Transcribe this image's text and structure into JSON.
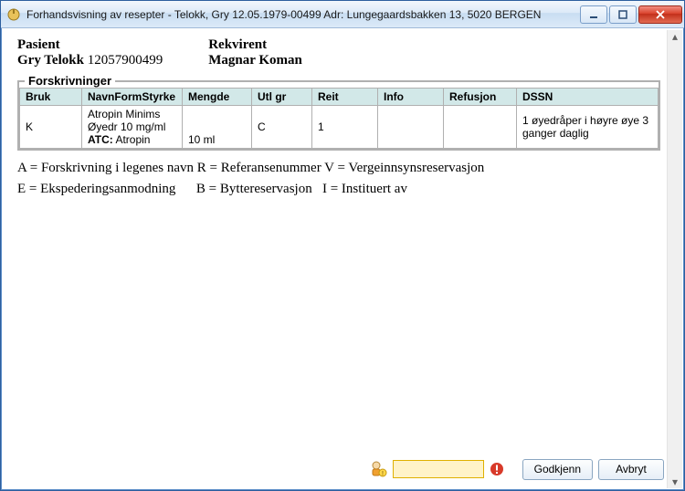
{
  "window": {
    "title": "Forhandsvisning av resepter - Telokk, Gry 12.05.1979-00499 Adr: Lungegaardsbakken 13, 5020 BERGEN"
  },
  "patient": {
    "label": "Pasient",
    "name": "Gry Telokk",
    "id": "12057900499"
  },
  "requester": {
    "label": "Rekvirent",
    "name": "Magnar Koman"
  },
  "prescriptions": {
    "legend": "Forskrivninger",
    "headers": {
      "bruk": "Bruk",
      "navn": "NavnFormStyrke",
      "mengde": "Mengde",
      "utlgr": "Utl gr",
      "reit": "Reit",
      "info": "Info",
      "refusjon": "Refusjon",
      "dssn": "DSSN"
    },
    "rows": [
      {
        "bruk": "K",
        "navn_pre": "Atropin Minims Øyedr 10 mg/ml ",
        "navn_atc_label": "ATC:",
        "navn_atc_value": " Atropin",
        "mengde": "10 ml",
        "utlgr": "C",
        "reit": "1",
        "info": "",
        "refusjon": "",
        "dssn": "1 øyedråper i høyre øye 3 ganger daglig"
      }
    ]
  },
  "legend_lines": {
    "line1": "A = Forskrivning i legenes navn R = Referansenummer V = Vergeinnsynsreservasjon",
    "line2": "E = Ekspederingsanmodning      B = Byttereservasjon   I = Instituert av"
  },
  "buttons": {
    "approve": "Godkjenn",
    "cancel": "Avbryt"
  },
  "search": {
    "value": "",
    "placeholder": ""
  }
}
